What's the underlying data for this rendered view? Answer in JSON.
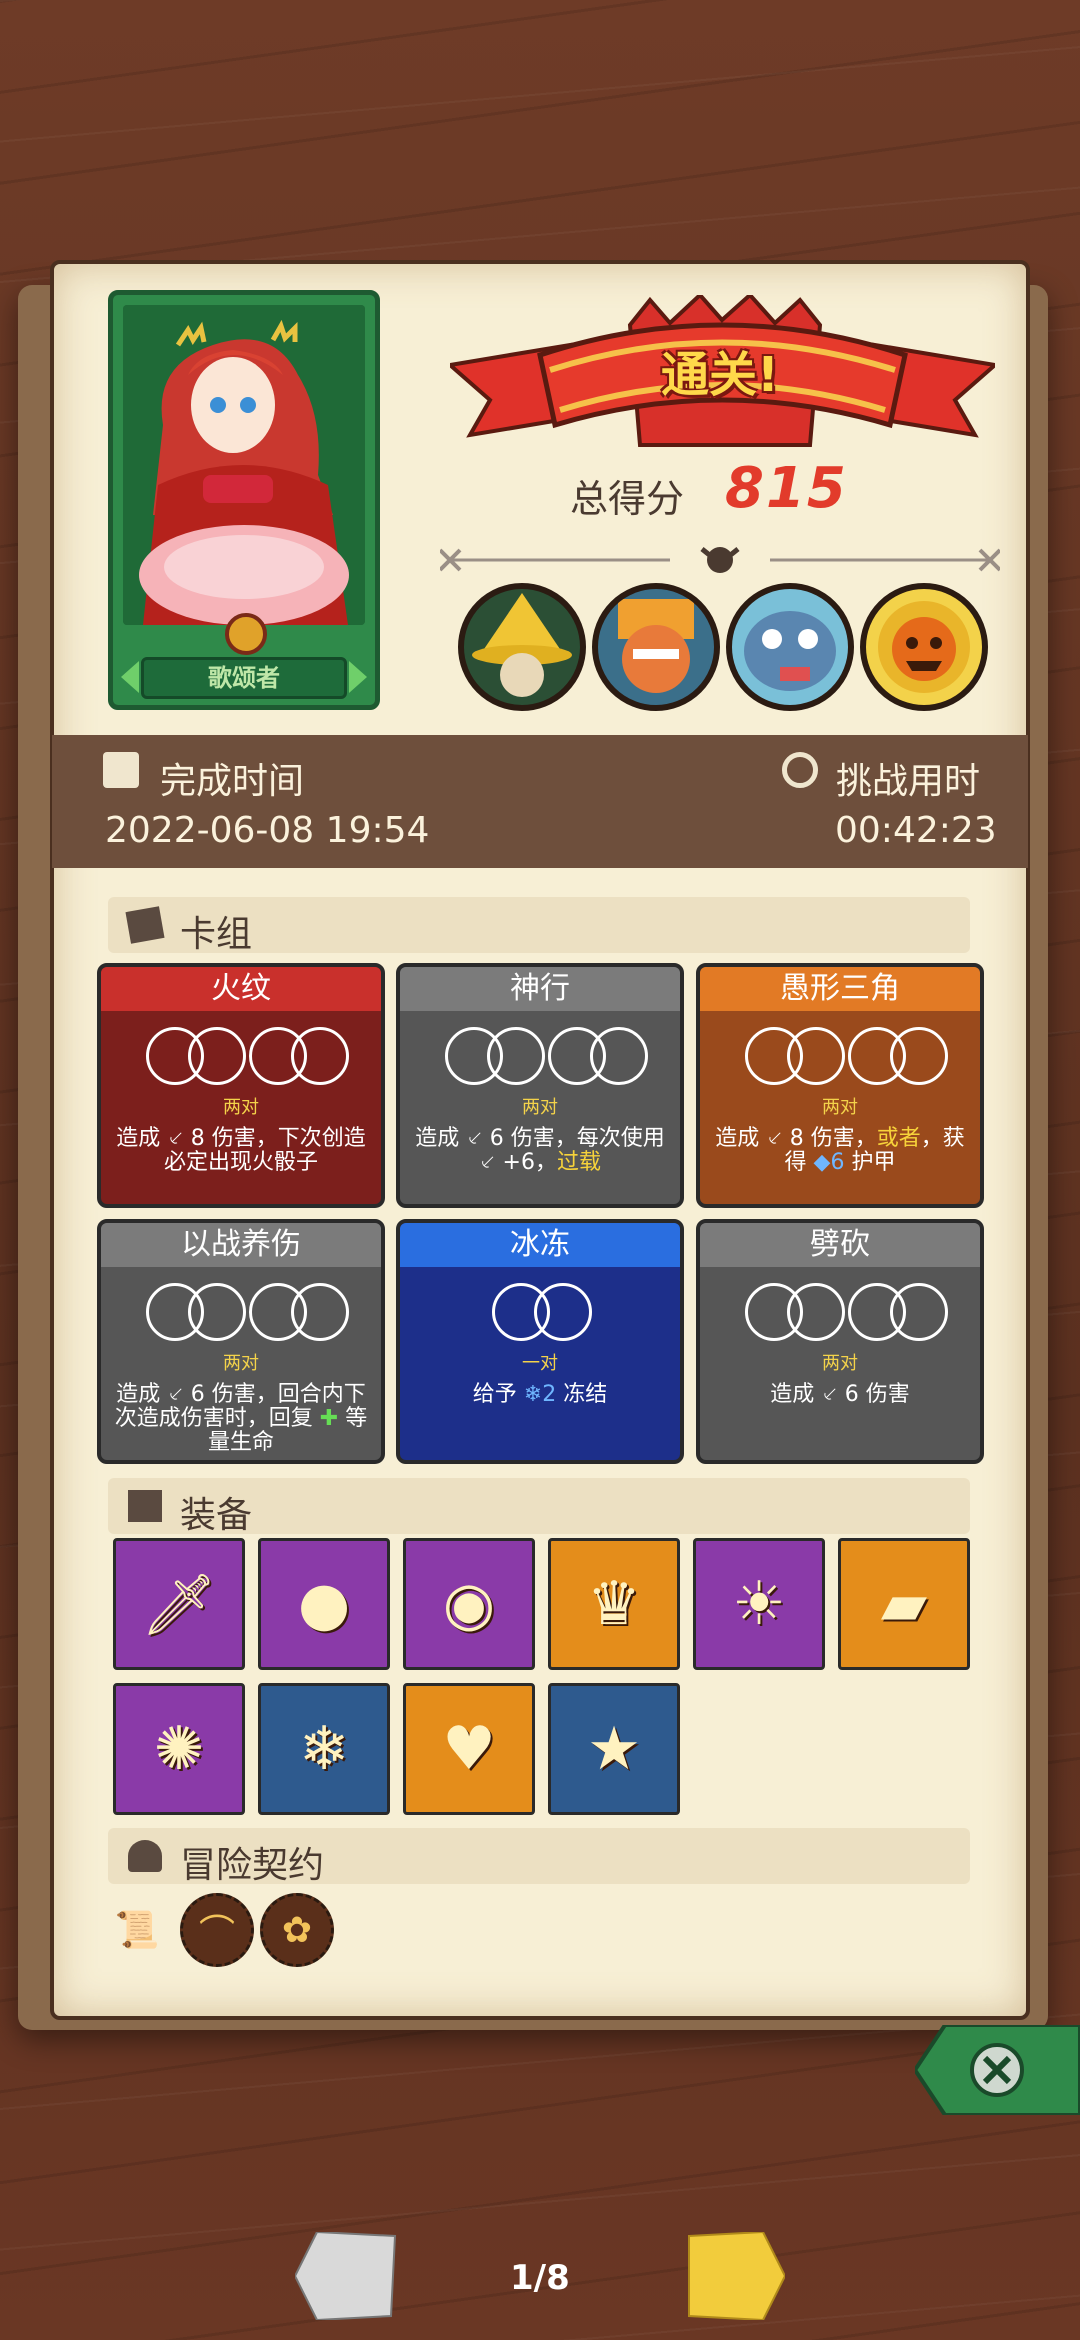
{
  "hero": {
    "name": "歌颂者"
  },
  "banner": {
    "title": "通关!"
  },
  "score": {
    "label": "总得分",
    "value": "815"
  },
  "time": {
    "finish_label": "完成时间",
    "finish_value": "2022-06-08 19:54",
    "duration_label": "挑战用时",
    "duration_value": "00:42:23"
  },
  "sections": {
    "deck": "卡组",
    "equipment": "装备",
    "contract": "冒险契约"
  },
  "cards": [
    {
      "title": "火纹",
      "pair": "两对",
      "desc_a": "造成 ",
      "desc_b": "8 伤害，下次创造必定出现火骰子",
      "color": "#7c1f1c",
      "title_color": "#c9302c"
    },
    {
      "title": "神行",
      "pair": "两对",
      "desc_a": "造成 ",
      "desc_b": "6 伤害，每次使用 ",
      "desc_c": "+6，",
      "desc_kw": "过载",
      "color": "#565656",
      "title_color": "#7b7b7b"
    },
    {
      "title": "愚形三角",
      "pair": "两对",
      "desc_a": "造成 ",
      "desc_b": "8 伤害，",
      "desc_kw": "或者",
      "desc_c": "，获得 ",
      "desc_d": "6",
      "desc_e": " 护甲",
      "color": "#9a4a1c",
      "title_color": "#e27a25"
    },
    {
      "title": "以战养伤",
      "pair": "两对",
      "desc_a": "造成 ",
      "desc_b": "6 伤害，回合内下次造成伤害时，回复 ",
      "desc_c": " 等量生命",
      "color": "#565656",
      "title_color": "#7b7b7b"
    },
    {
      "title": "冰冻",
      "pair": "一对",
      "desc_a": "给予 ",
      "desc_d": "2",
      "desc_c": " 冻结",
      "color": "#1d2f8a",
      "title_color": "#2a6ee0"
    },
    {
      "title": "劈砍",
      "pair": "两对",
      "desc_a": "造成 ",
      "desc_b": "6 伤害",
      "color": "#565656",
      "title_color": "#7b7b7b"
    }
  ],
  "equipment": [
    {
      "icon": "umbrella-sword-icon",
      "frame": "purple"
    },
    {
      "icon": "red-bird-icon",
      "frame": "purple"
    },
    {
      "icon": "spotted-egg-icon",
      "frame": "purple"
    },
    {
      "icon": "golden-crown-icon",
      "frame": "orange"
    },
    {
      "icon": "sun-mask-icon",
      "frame": "purple"
    },
    {
      "icon": "green-tablet-icon",
      "frame": "orange"
    },
    {
      "icon": "gem-plate-icon",
      "frame": "purple"
    },
    {
      "icon": "snow-scroll-icon",
      "frame": "blue"
    },
    {
      "icon": "heart-chest-icon",
      "frame": "orange"
    },
    {
      "icon": "star-orb-icon",
      "frame": "blue"
    }
  ],
  "contracts": [
    {
      "icon": "scroll-icon"
    },
    {
      "icon": "pipe-icon"
    },
    {
      "icon": "flower-pot-icon"
    }
  ],
  "bosses": [
    {
      "icon": "yellow-hat-boss-icon"
    },
    {
      "icon": "horned-warrior-boss-icon"
    },
    {
      "icon": "blue-beast-boss-icon"
    },
    {
      "icon": "pumpkin-boss-icon"
    }
  ],
  "pagination": {
    "label": "1/8"
  },
  "colors": {
    "accent_red": "#e23b2b",
    "banner_gold": "#ffd84a",
    "paper": "#f7efd5",
    "band": "#6e4f3c"
  }
}
